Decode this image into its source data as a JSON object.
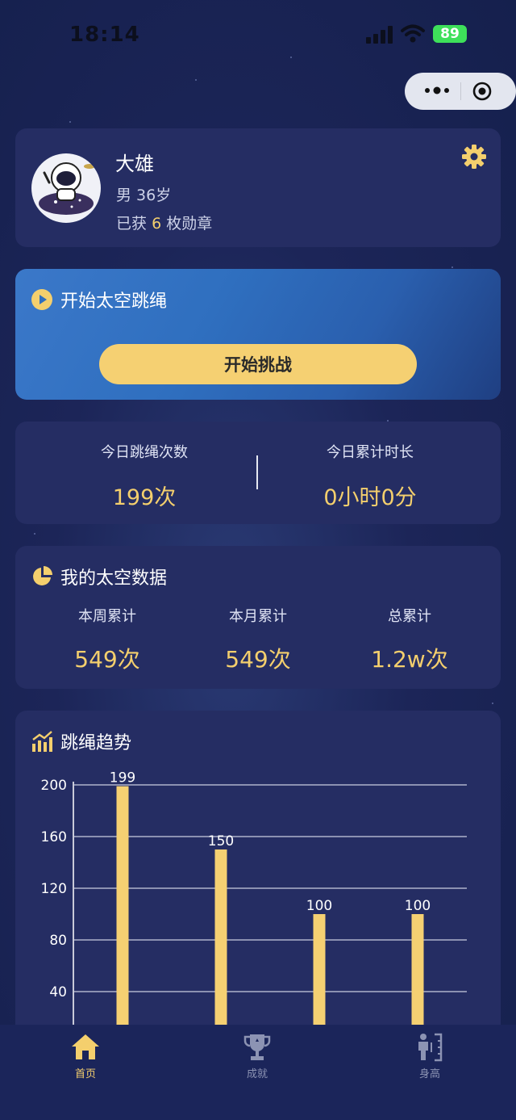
{
  "status_bar": {
    "time": "18:14",
    "battery": "89"
  },
  "profile": {
    "name": "大雄",
    "gender_age": "男 36岁",
    "medals_prefix": "已获",
    "medals_count": "6",
    "medals_suffix": "枚勋章"
  },
  "start": {
    "title": "开始太空跳绳",
    "button_label": "开始挑战"
  },
  "today": {
    "count_label": "今日跳绳次数",
    "count_value": "199次",
    "duration_label": "今日累计时长",
    "duration_value": "0小时0分"
  },
  "space_data": {
    "title": "我的太空数据",
    "week_label": "本周累计",
    "week_value": "549次",
    "month_label": "本月累计",
    "month_value": "549次",
    "total_label": "总累计",
    "total_value": "1.2w次"
  },
  "trend": {
    "title": "跳绳趋势"
  },
  "chart_data": {
    "type": "bar",
    "values": [
      199,
      150,
      100,
      100
    ],
    "data_labels": [
      "199",
      "150",
      "100",
      "100"
    ],
    "y_ticks": [
      "40",
      "80",
      "120",
      "160",
      "200"
    ],
    "ylim": [
      0,
      200
    ],
    "grid": true,
    "bar_color": "#f5d072"
  },
  "tabs": [
    {
      "label": "首页",
      "icon": "home-icon",
      "active": true
    },
    {
      "label": "成就",
      "icon": "trophy-icon",
      "active": false
    },
    {
      "label": "身高",
      "icon": "height-icon",
      "active": false
    }
  ],
  "colors": {
    "accent": "#f4cf6d",
    "card": "#252d63",
    "tab_active": "#f4cf6d",
    "tab_inactive": "#8c93b3"
  }
}
